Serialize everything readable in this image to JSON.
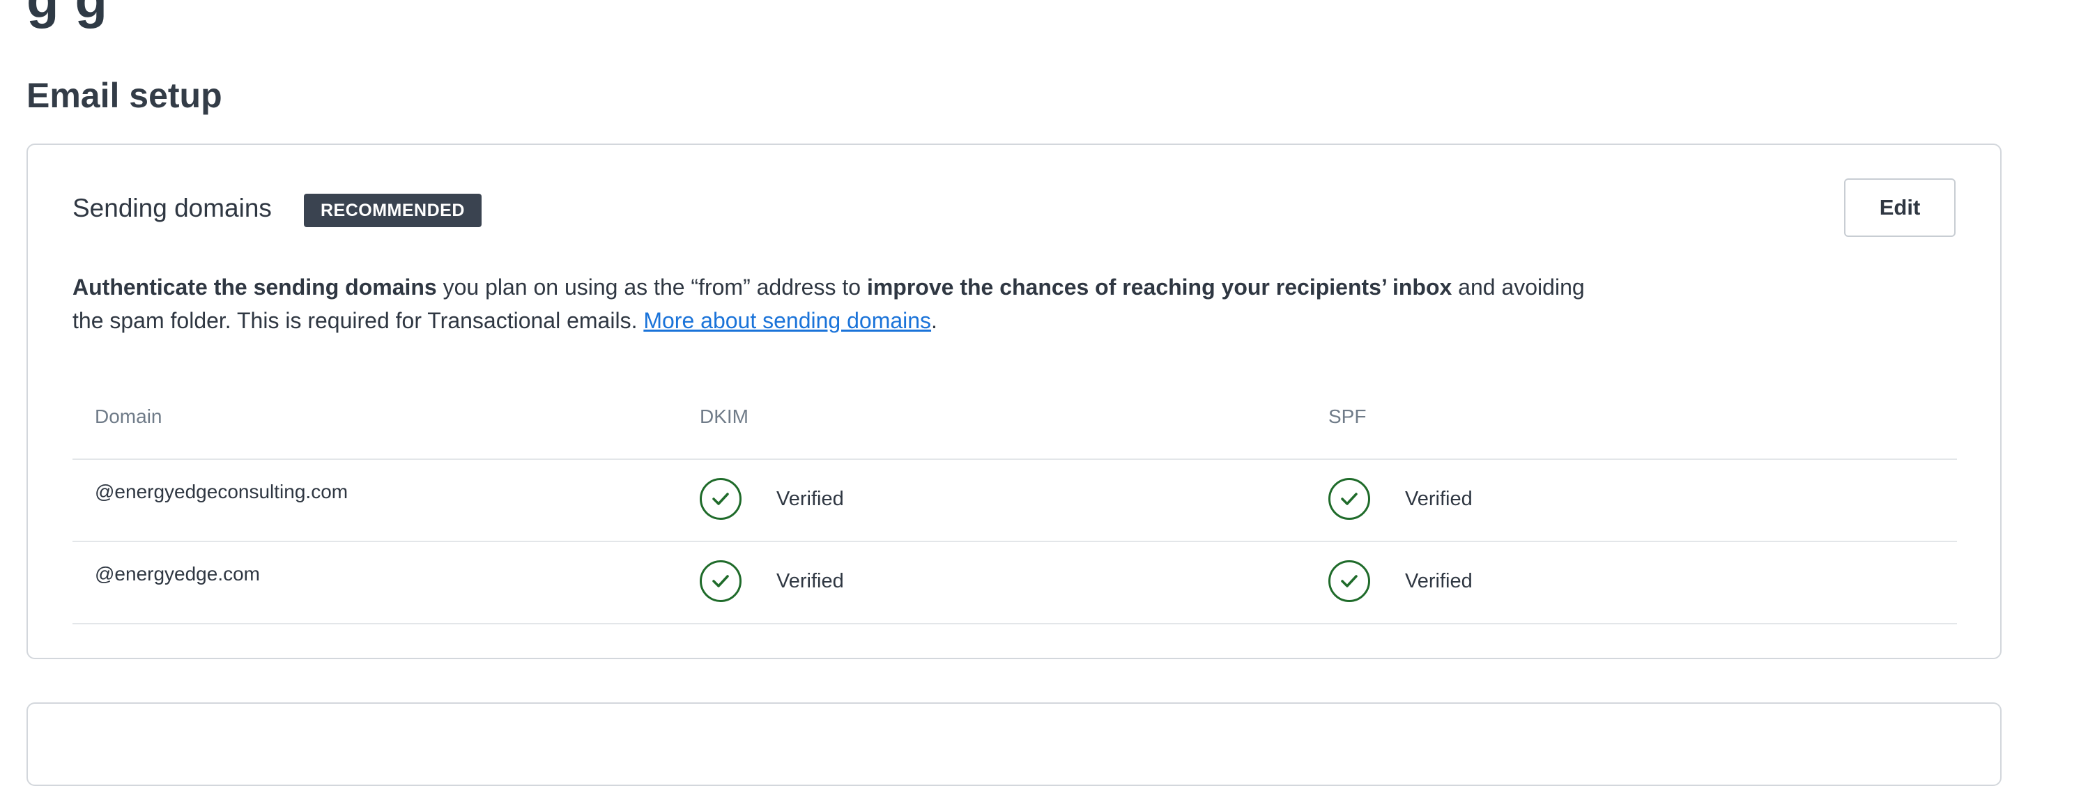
{
  "top_cutoff_text": "g g",
  "page_title": "Email setup",
  "sending_domains": {
    "title": "Sending domains",
    "badge": "RECOMMENDED",
    "edit_label": "Edit",
    "description": {
      "bold_1": "Authenticate the sending domains",
      "text_1": " you plan on using as the “from” address to ",
      "bold_2": "improve the chances of reaching your recipients’ inbox",
      "text_2": " and avoiding the spam folder. This is required for Transactional emails. ",
      "link": "More about sending domains",
      "text_3": "."
    },
    "table": {
      "headers": {
        "domain": "Domain",
        "dkim": "DKIM",
        "spf": "SPF"
      },
      "rows": [
        {
          "domain": "@energyedgeconsulting.com",
          "dkim": "Verified",
          "spf": "Verified"
        },
        {
          "domain": "@energyedge.com",
          "dkim": "Verified",
          "spf": "Verified"
        }
      ]
    }
  },
  "colors": {
    "accent_link": "#1a73d9",
    "verified_green": "#1f6b2a",
    "badge_bg": "#3a4350"
  },
  "icons": {
    "status": "check-circle-icon"
  }
}
